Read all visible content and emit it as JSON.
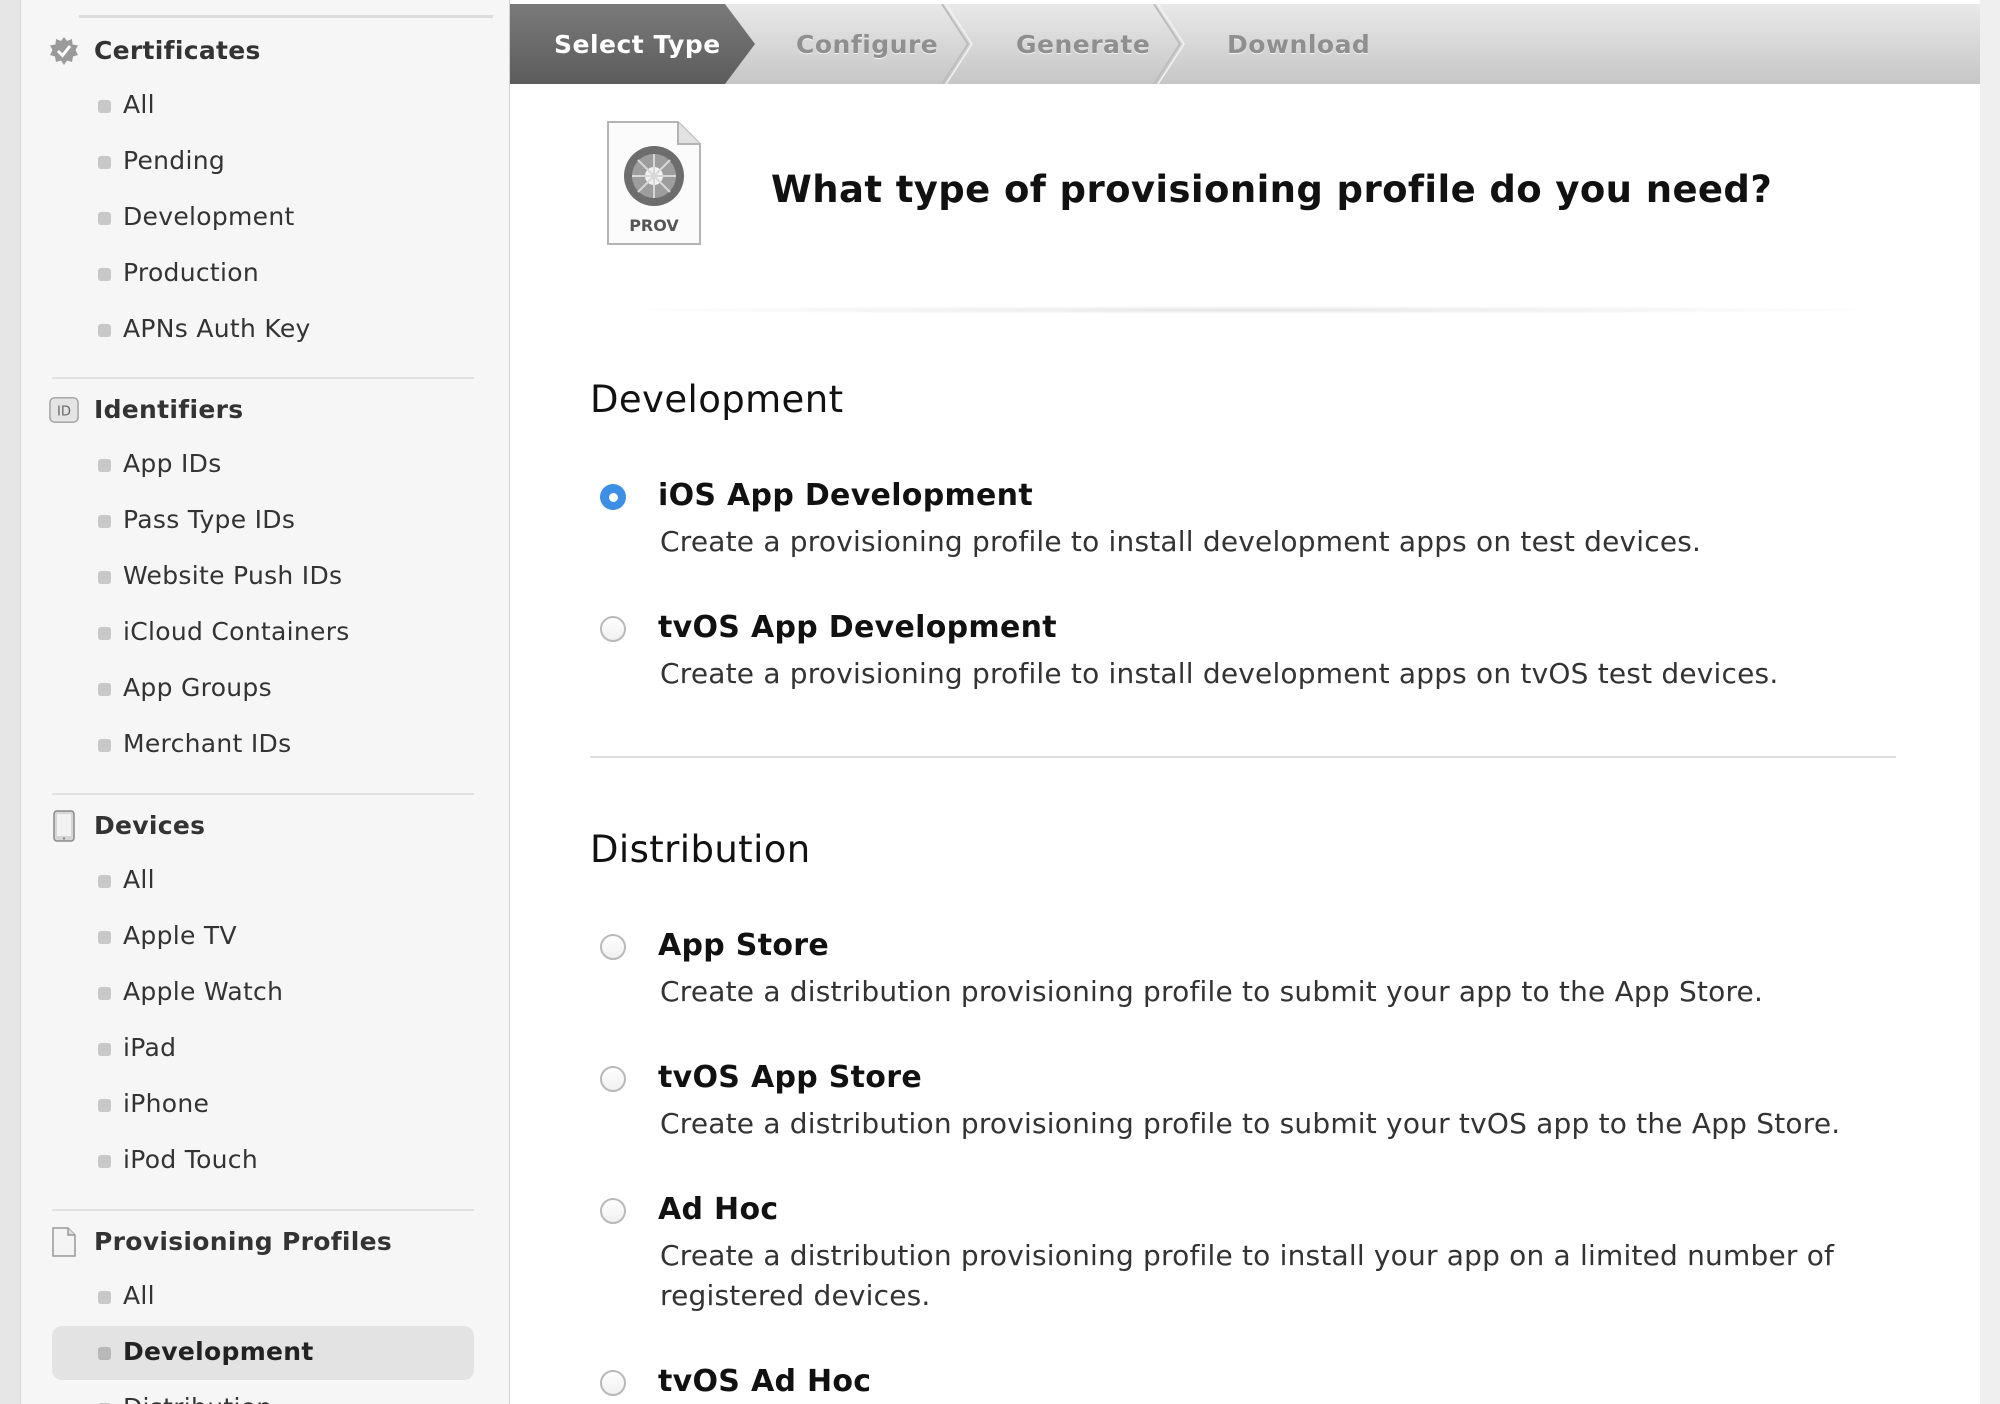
{
  "sidebar": {
    "sections": [
      {
        "title": "Certificates",
        "icon": "certificate-badge-icon",
        "items": [
          "All",
          "Pending",
          "Development",
          "Production",
          "APNs Auth Key"
        ]
      },
      {
        "title": "Identifiers",
        "icon": "id-badge-icon",
        "icon_text": "ID",
        "items": [
          "App IDs",
          "Pass Type IDs",
          "Website Push IDs",
          "iCloud Containers",
          "App Groups",
          "Merchant IDs"
        ]
      },
      {
        "title": "Devices",
        "icon": "device-icon",
        "items": [
          "All",
          "Apple TV",
          "Apple Watch",
          "iPad",
          "iPhone",
          "iPod Touch"
        ]
      },
      {
        "title": "Provisioning Profiles",
        "icon": "document-icon",
        "items": [
          "All",
          "Development",
          "Distribution"
        ],
        "selected": "Development"
      }
    ]
  },
  "steps": [
    "Select Type",
    "Configure",
    "Generate",
    "Download"
  ],
  "active_step": "Select Type",
  "header": {
    "icon_label": "PROV",
    "question": "What type of provisioning profile do you need?"
  },
  "groups": [
    {
      "title": "Development",
      "options": [
        {
          "title": "iOS App Development",
          "desc": "Create a provisioning profile to install development apps on test devices.",
          "checked": true
        },
        {
          "title": "tvOS App Development",
          "desc": "Create a provisioning profile to install development apps on tvOS test devices.",
          "checked": false
        }
      ]
    },
    {
      "title": "Distribution",
      "options": [
        {
          "title": "App Store",
          "desc": "Create a distribution provisioning profile to submit your app to the App Store.",
          "checked": false
        },
        {
          "title": "tvOS App Store",
          "desc": "Create a distribution provisioning profile to submit your tvOS app to the App Store.",
          "checked": false
        },
        {
          "title": "Ad Hoc",
          "desc": "Create a distribution provisioning profile to install your app on a limited number of registered devices.",
          "checked": false
        },
        {
          "title": "tvOS Ad Hoc",
          "desc": "",
          "checked": false
        }
      ]
    }
  ],
  "colors": {
    "accent": "#3d8fe6",
    "step_active": "#6b6b6b",
    "step_bar": "#cfcfcf"
  }
}
